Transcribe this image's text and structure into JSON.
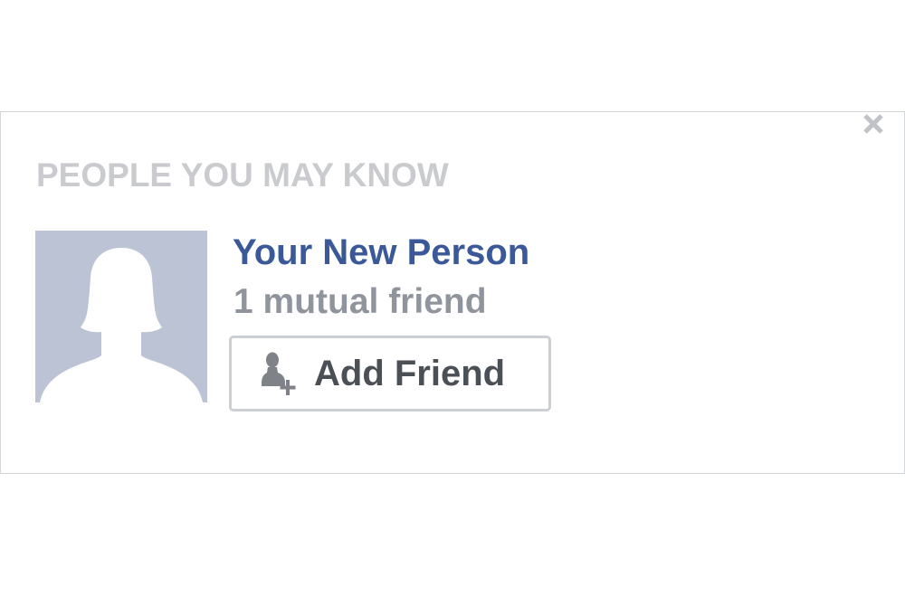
{
  "section": {
    "title": "PEOPLE YOU MAY KNOW",
    "close_icon": "close-icon"
  },
  "suggestion": {
    "avatar_icon": "default-profile-silhouette-icon",
    "name": "Your New Person",
    "mutual_friends": "1 mutual friend",
    "add_button": {
      "label": "Add Friend",
      "icon": "add-friend-icon"
    }
  },
  "colors": {
    "name_link": "#3b5998",
    "title": "#c9cbce",
    "secondary_text": "#90949c",
    "button_text": "#4b4f56",
    "avatar_bg": "#bcc3d5"
  }
}
